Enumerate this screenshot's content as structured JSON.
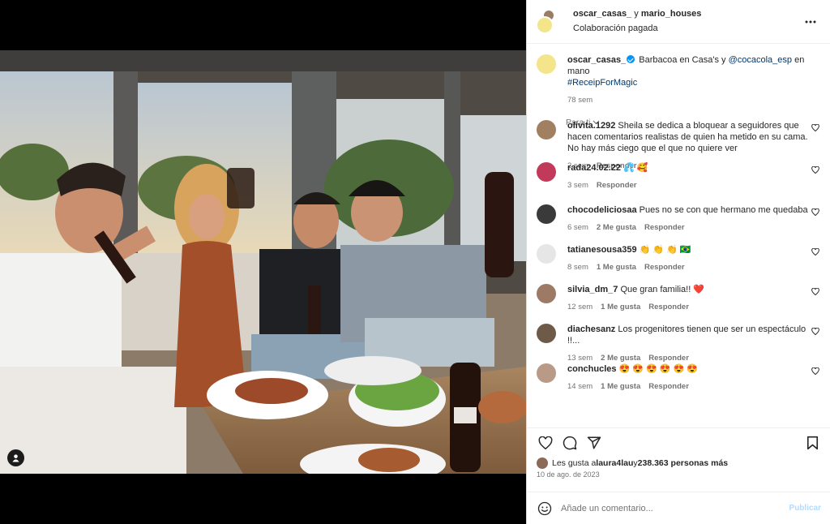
{
  "header": {
    "account1": "oscar_casas_",
    "joiner": " y ",
    "account2": "mario_houses",
    "subtitle": "Colaboración pagada",
    "more_icon": "more-horizontal-icon"
  },
  "caption": {
    "username": "oscar_casas_",
    "text_before": " Barbacoa en Casa's y ",
    "mention": "@cocacola_esp",
    "text_after": " en mano ",
    "hashtag": "#ReceipForMagic",
    "time": "78 sem"
  },
  "filter_label": "Para ti",
  "comments": [
    {
      "username": "olivita.1292",
      "text": "Sheila se dedica a bloquear a seguidores que hacen comentarios realistas de quien ha metido en su cama. No hay más ciego que el que no quiere ver",
      "time": "2 sem",
      "likes": "",
      "reply": "Responder",
      "avatar_color": "#a08060"
    },
    {
      "username": "rada24.02.22",
      "text": "💦 🥰",
      "time": "3 sem",
      "likes": "",
      "reply": "Responder",
      "avatar_color": "#c23a5a"
    },
    {
      "username": "chocodeliciosaa",
      "text": "Pues no se con que hermano me quedaba",
      "time": "6 sem",
      "likes": "2 Me gusta",
      "reply": "Responder",
      "avatar_color": "#3a3a3a"
    },
    {
      "username": "tatianesousa359",
      "text": "👏 👏 👏 🇧🇷",
      "time": "8 sem",
      "likes": "1 Me gusta",
      "reply": "Responder",
      "avatar_color": "#e6e6e6"
    },
    {
      "username": "silvia_dm_7",
      "text": "Que gran familia!! ❤️",
      "time": "12 sem",
      "likes": "1 Me gusta",
      "reply": "Responder",
      "avatar_color": "#9c7a66"
    },
    {
      "username": "diachesanz",
      "text": "Los progenitores tienen que ser un espectáculo !!...",
      "time": "13 sem",
      "likes": "2 Me gusta",
      "reply": "Responder",
      "avatar_color": "#6e5a48"
    },
    {
      "username": "conchucles",
      "text": "😍 😍 😍 😍 😍 😍",
      "time": "14 sem",
      "likes": "1 Me gusta",
      "reply": "Responder",
      "avatar_color": "#b89a86"
    }
  ],
  "actions": {
    "like_icon": "heart-icon",
    "comment_icon": "comment-icon",
    "share_icon": "send-icon",
    "save_icon": "bookmark-icon"
  },
  "likes": {
    "prefix": "Les gusta a ",
    "user": "laura4lau",
    "middle": " y ",
    "count": "238.363 personas más"
  },
  "date": "10 de ago. de 2023",
  "add_comment": {
    "placeholder": "Añade un comentario...",
    "publish": "Publicar"
  }
}
